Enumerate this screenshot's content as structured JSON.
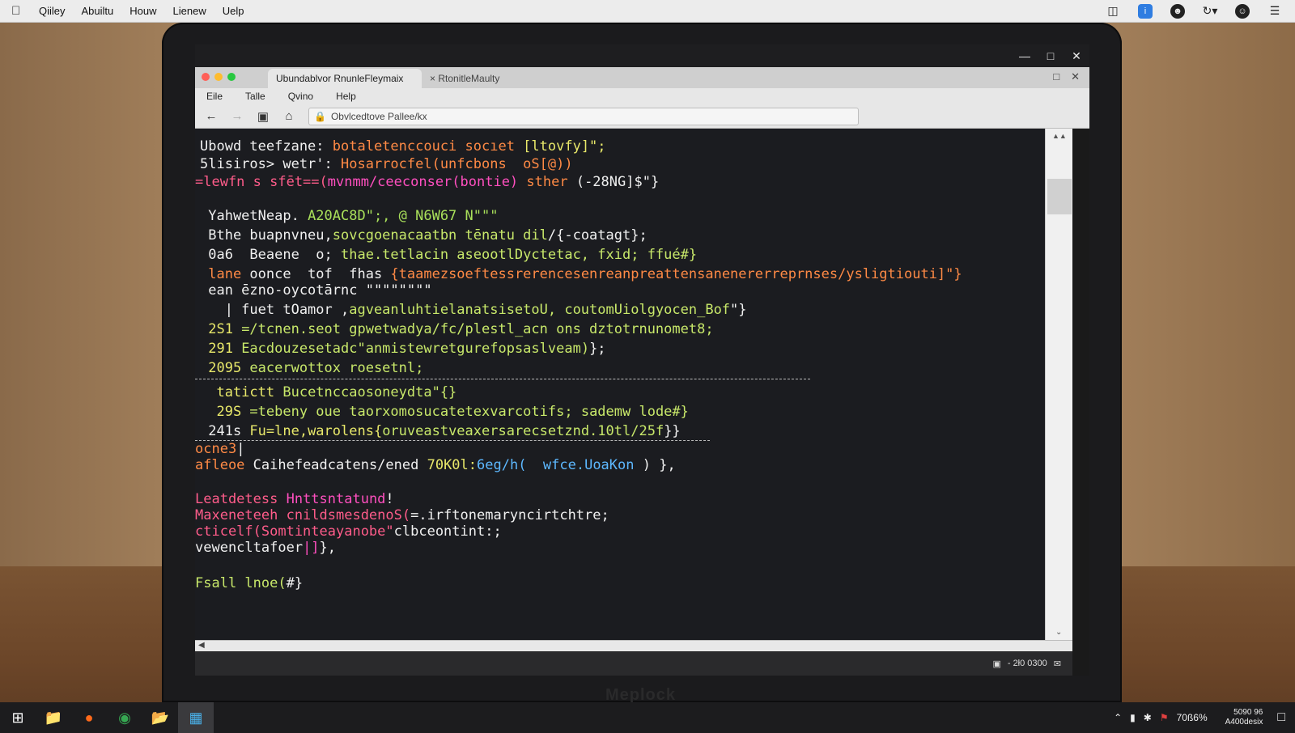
{
  "menubar": {
    "items": [
      "Qiiley",
      "Abuiltu",
      "Houw",
      "Lienew",
      "Uelp"
    ]
  },
  "laptop_brand": "Meplock",
  "browser": {
    "tabs": [
      {
        "label": "Ubundablvor  RnunleFleymaix"
      },
      {
        "label": "× RtonitleMaulty"
      }
    ],
    "menu": [
      "Eile",
      "Talle",
      "Qvino",
      "Help"
    ],
    "url": "Obvlcedtove Pallee/kx"
  },
  "terminal_lines": [
    {
      "segments": [
        {
          "t": "Ubowd teefzane: ",
          "c": "c-white"
        },
        {
          "t": "botaletenccouci socıet ",
          "c": "c-orange"
        },
        {
          "t": "[ltovfy]\";",
          "c": "c-yellow"
        }
      ]
    },
    {
      "segments": [
        {
          "t": "5lisiros> wetr': ",
          "c": "c-white"
        },
        {
          "t": "Hosarrocfel(unfcbons  oS[@))",
          "c": "c-orange"
        }
      ]
    },
    {
      "segments": [
        {
          "t": "=lewfn s sfēt==(",
          "c": "c-pink"
        },
        {
          "t": "mvnmm/ceeconser(bontie) ",
          "c": "c-magenta"
        },
        {
          "t": "sther ",
          "c": "c-orange"
        },
        {
          "t": "(-28NG]$\"}",
          "c": "c-white"
        }
      ]
    },
    {
      "segments": [
        {
          "t": " YahwetNeap. ",
          "c": "c-white"
        },
        {
          "t": "A20AC8D\";, @ N6W67 N\"\"\"",
          "c": "c-green"
        }
      ]
    },
    {
      "segments": [
        {
          "t": " Bthe buapnvneu,",
          "c": "c-white"
        },
        {
          "t": "sovcgoenacaatbn tēnatu dil",
          "c": "c-lime"
        },
        {
          "t": "/{-coatagt};",
          "c": "c-white"
        }
      ]
    },
    {
      "segments": [
        {
          "t": " 0a6  Beaene  o; ",
          "c": "c-white"
        },
        {
          "t": "thae.tetlacin aseootlDyctetac, fxid; ffué#}",
          "c": "c-lime"
        }
      ]
    },
    {
      "segments": [
        {
          "t": " lane ",
          "c": "c-orange"
        },
        {
          "t": "oonce  tof  fhas ",
          "c": "c-white"
        },
        {
          "t": "{taamezsoeftessrerencesenreanpreattensanenererreprnses/ysligtiouti]\"}",
          "c": "c-orange"
        }
      ]
    },
    {
      "segments": [
        {
          "t": " ean ēzno-oycotārnc ",
          "c": "c-white"
        },
        {
          "t": "\"\"\"\"\"\"\"\"",
          "c": "c-white"
        }
      ]
    },
    {
      "segments": [
        {
          "t": "   | fuet tOamor ,",
          "c": "c-white"
        },
        {
          "t": "agveanluhtielanatsisetoU, coutomUiolgyocen_Bof",
          "c": "c-lime"
        },
        {
          "t": "\"}",
          "c": "c-white"
        }
      ]
    },
    {
      "segments": [
        {
          "t": " 2S1 ",
          "c": "c-yellow"
        },
        {
          "t": "=/tcnen.seot gpwetwadya/fc/plestl_acn ons dztotrnunomet8;",
          "c": "c-lime"
        }
      ]
    },
    {
      "segments": [
        {
          "t": " 291 ",
          "c": "c-yellow"
        },
        {
          "t": "Eacdouzesetadc\"anmistewretgurefopsaslveam)",
          "c": "c-lime"
        },
        {
          "t": "};",
          "c": "c-white"
        }
      ]
    },
    {
      "segments": [
        {
          "t": " 2095 ",
          "c": "c-yellow"
        },
        {
          "t": "eacerwottox roesetnl;",
          "c": "c-lime"
        }
      ]
    },
    {
      "segments": [
        {
          "t": "  tatictt ",
          "c": "c-yellow"
        },
        {
          "t": "Bucetnccaosoneydta\"{}",
          "c": "c-lime"
        }
      ]
    },
    {
      "segments": [
        {
          "t": "  29S ",
          "c": "c-yellow"
        },
        {
          "t": "=tebeny oue taorxomosucatetexvarcotifs; ",
          "c": "c-lime"
        },
        {
          "t": "sademw lode#}",
          "c": "c-lime"
        }
      ]
    },
    {
      "segments": [
        {
          "t": " 241s ",
          "c": "c-white"
        },
        {
          "t": "Fu=lne,warolens{",
          "c": "c-yellow"
        },
        {
          "t": "oruveastveaxersarecsetznd.10tl/25f",
          "c": "c-lime"
        },
        {
          "t": "}}",
          "c": "c-white"
        }
      ]
    },
    {
      "segments": [
        {
          "t": "ocne3",
          "c": "c-orange"
        },
        {
          "t": "|",
          "c": "c-white"
        }
      ]
    },
    {
      "segments": [
        {
          "t": "afleoe ",
          "c": "c-orange"
        },
        {
          "t": "Caihefeadcatens/ened ",
          "c": "c-white"
        },
        {
          "t": "70K0l:",
          "c": "c-yellow"
        },
        {
          "t": "6eg/h( ",
          "c": "c-blue"
        },
        {
          "t": " wfce.UoaKon ",
          "c": "c-blue"
        },
        {
          "t": ") },",
          "c": "c-white"
        }
      ]
    },
    {
      "segments": [
        {
          "t": "Leatdetess ",
          "c": "c-pink"
        },
        {
          "t": "Hnttsntatund",
          "c": "c-magenta"
        },
        {
          "t": "!",
          "c": "c-white"
        }
      ]
    },
    {
      "segments": [
        {
          "t": "Maxeneteeh cnildsmesdenoS(",
          "c": "c-pink"
        },
        {
          "t": "=.irftonemaryncirtchtre;",
          "c": "c-white"
        }
      ]
    },
    {
      "segments": [
        {
          "t": "cticelf(Somtinteayanobe\"",
          "c": "c-pink"
        },
        {
          "t": "clbceontint:;",
          "c": "c-white"
        }
      ]
    },
    {
      "segments": [
        {
          "t": "vewencltafoer",
          "c": "c-white"
        },
        {
          "t": "|]",
          "c": "c-magenta"
        },
        {
          "t": "},",
          "c": "c-white"
        }
      ]
    },
    {
      "segments": [
        {
          "t": "Fsall lnoe(",
          "c": "c-lime"
        },
        {
          "t": "#",
          "c": "c-white"
        },
        {
          "t": "}",
          "c": "c-white"
        }
      ]
    }
  ],
  "statusbar": {
    "text": "- 2ł0 0300"
  },
  "taskbar": {
    "tray_text": "70ß6%",
    "clock_line1": "5090 96",
    "clock_line2": "A400desix"
  }
}
